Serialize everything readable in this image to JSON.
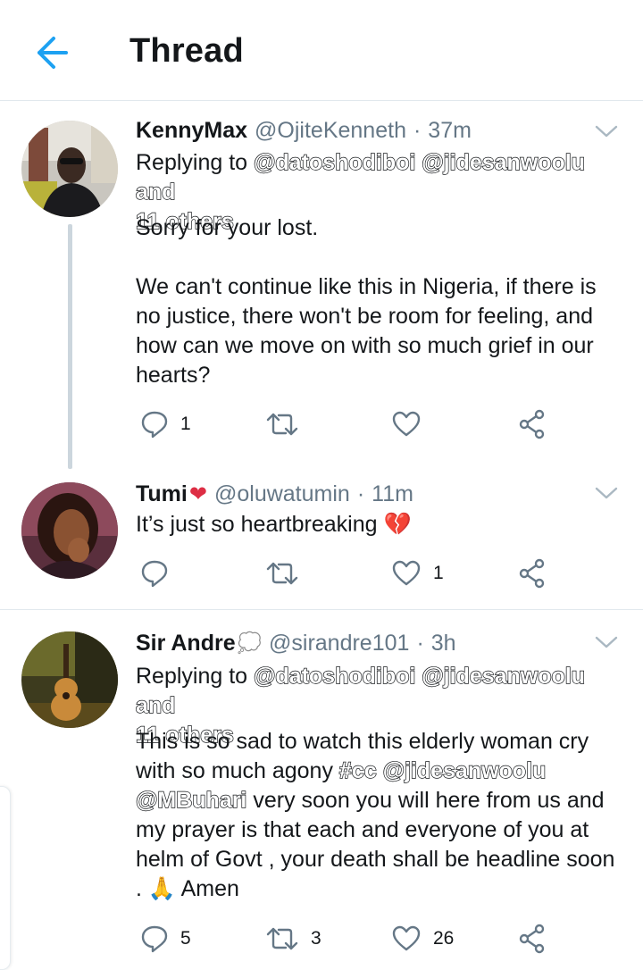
{
  "header": {
    "title": "Thread"
  },
  "colors": {
    "accent": "#1da1f2",
    "text": "#14171a",
    "secondary": "#657786",
    "heart_emoji": "#dd2e44"
  },
  "tweets": [
    {
      "name": "KennyMax",
      "handle": "@OjiteKenneth",
      "dot": "·",
      "time": "37m",
      "reply_prefix": "Replying to",
      "reply_mentions_line1": "@datoshodiboi @jidesanwoolu and",
      "reply_mentions_line2": "11 others",
      "text_line1": "Sorry for your lost.",
      "text_para2": "We can't continue like this in Nigeria, if there is no justice, there won't be room for feeling, and how can we move on with so much grief in our hearts?",
      "reply_count": "1",
      "retweet_count": "",
      "like_count": ""
    },
    {
      "name": "Tumi",
      "name_emoji": "❤",
      "handle": "@oluwatumin",
      "dot": "·",
      "time": "11m",
      "text": "It’s just so heartbreaking",
      "text_emoji": "💔",
      "reply_count": "",
      "retweet_count": "",
      "like_count": "1"
    },
    {
      "name": "Sir Andre",
      "name_emoji": "💭",
      "handle": "@sirandre101",
      "dot": "·",
      "time": "3h",
      "reply_prefix": "Replying to",
      "reply_mentions_line1": "@datoshodiboi @jidesanwoolu and",
      "reply_mentions_line2": "11 others",
      "text_part1": "This is so sad to watch this elderly woman cry with so much agony ",
      "text_tags": "#cc @jidesanwoolu",
      "text_mention2": "@MBuhari",
      "text_part2": " very soon you will here from us and my prayer is that each and everyone of you at helm of Govt , your death shall be headline soon .",
      "text_emoji": "🙏",
      "text_part3": " Amen",
      "reply_count": "5",
      "retweet_count": "3",
      "like_count": "26"
    }
  ],
  "icons": {
    "back": "arrow-left-icon",
    "chevron": "chevron-down-icon",
    "reply": "reply-icon",
    "retweet": "retweet-icon",
    "like": "heart-icon",
    "share": "share-icon"
  }
}
